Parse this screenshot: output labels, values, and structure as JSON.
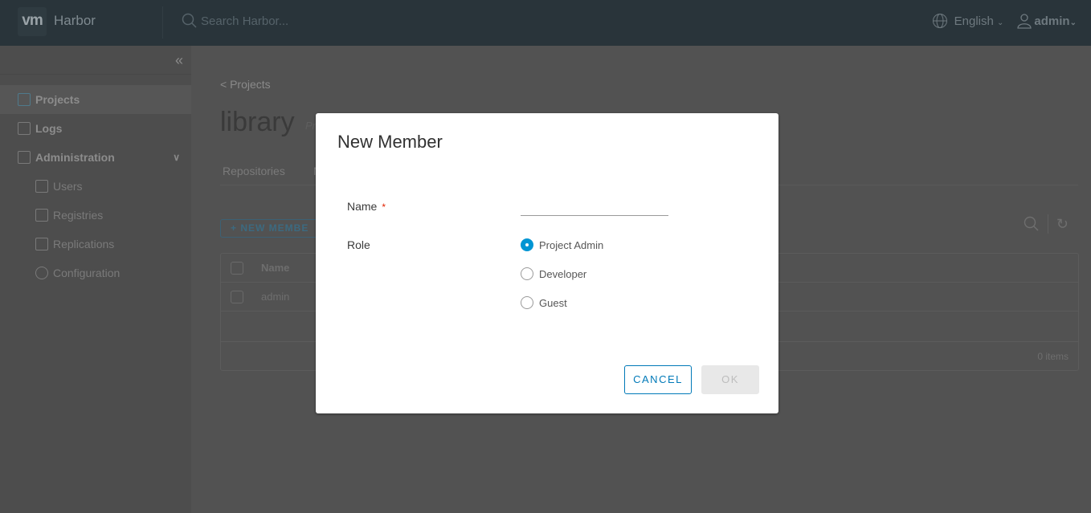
{
  "header": {
    "logo": "vm",
    "brand": "Harbor",
    "search_placeholder": "Search Harbor...",
    "language": "English",
    "user": "admin"
  },
  "sidebar": {
    "items": [
      {
        "label": "Projects",
        "icon": "org-chart-icon",
        "active": true
      },
      {
        "label": "Logs",
        "icon": "document-list-icon"
      },
      {
        "label": "Administration",
        "icon": "user-gear-icon",
        "expanded": true
      },
      {
        "label": "Users",
        "icon": "users-icon"
      },
      {
        "label": "Registries",
        "icon": "cube-icon"
      },
      {
        "label": "Replications",
        "icon": "cloud-sync-icon"
      },
      {
        "label": "Configuration",
        "icon": "gear-icon"
      }
    ]
  },
  "main": {
    "breadcrumb": "< Projects",
    "title": "library",
    "subtitle_fragment": "Pr",
    "tabs": [
      {
        "label": "Repositories"
      },
      {
        "label": "M",
        "active": true
      }
    ],
    "new_member_label": "+ NEW MEMBE",
    "grid": {
      "header": "Name",
      "rows": [
        "admin"
      ],
      "footer": "0 items"
    }
  },
  "modal": {
    "title": "New Member",
    "name_label": "Name",
    "required_mark": "*",
    "name_value": "",
    "role_label": "Role",
    "roles": [
      {
        "label": "Project Admin",
        "selected": true
      },
      {
        "label": "Developer"
      },
      {
        "label": "Guest"
      }
    ],
    "cancel_label": "CANCEL",
    "ok_label": "OK",
    "accent_color": "#0079b8"
  }
}
